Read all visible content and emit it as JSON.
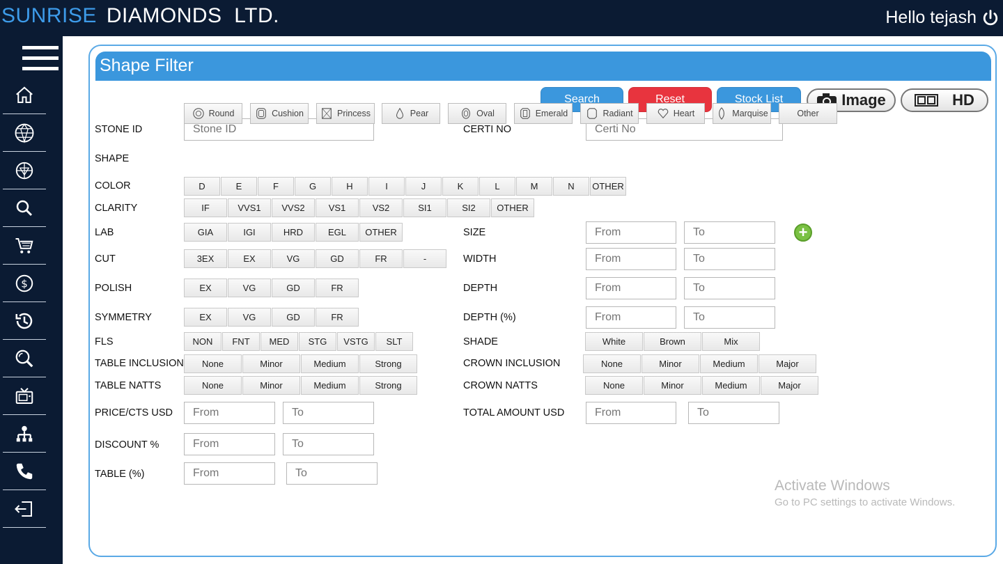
{
  "header": {
    "brand_part1": "SUNRISE",
    "brand_part2": "DIAMONDS  LTD.",
    "greeting": "Hello tejash"
  },
  "sidebar": {
    "items": [
      "menu-icon",
      "home-icon",
      "diamond-icon",
      "diamond-ring-icon",
      "search-icon",
      "cart-icon",
      "dollar-refresh-icon",
      "history-icon",
      "zoom-search-icon",
      "tv-icon",
      "network-icon",
      "phone-icon",
      "logout-icon"
    ]
  },
  "panel": {
    "title": "Shape Filter"
  },
  "actions": {
    "search": "Search",
    "reset": "Reset",
    "stock_list": "Stock List",
    "image": "Image",
    "hd": "HD"
  },
  "labels": {
    "stone_id": "STONE ID",
    "certi_no": "CERTI NO",
    "shape": "SHAPE",
    "color": "COLOR",
    "clarity": "CLARITY",
    "lab": "LAB",
    "size": "SIZE",
    "cut": "CUT",
    "width": "WIDTH",
    "polish": "POLISH",
    "depth": "DEPTH",
    "symmetry": "SYMMETRY",
    "depth_pct": "DEPTH (%)",
    "fls": "FLS",
    "shade": "SHADE",
    "table_inclusion": "TABLE INCLUSION",
    "crown_inclusion": "CROWN INCLUSION",
    "table_natts": "TABLE NATTS",
    "crown_natts": "CROWN NATTS",
    "price_cts": "PRICE/CTS USD",
    "total_amount": "TOTAL AMOUNT USD",
    "discount": "DISCOUNT %",
    "table_pct": "TABLE (%)"
  },
  "placeholders": {
    "stone_id": "Stone ID",
    "certi_no": "Certi No",
    "from": "From",
    "to": "To"
  },
  "shapes": [
    "Round",
    "Cushion",
    "Princess",
    "Pear",
    "Oval",
    "Emerald",
    "Radiant",
    "Heart",
    "Marquise",
    "Other"
  ],
  "colors": [
    "D",
    "E",
    "F",
    "G",
    "H",
    "I",
    "J",
    "K",
    "L",
    "M",
    "N",
    "OTHER"
  ],
  "clarity": [
    "IF",
    "VVS1",
    "VVS2",
    "VS1",
    "VS2",
    "SI1",
    "SI2",
    "OTHER"
  ],
  "lab": [
    "GIA",
    "IGI",
    "HRD",
    "EGL",
    "OTHER"
  ],
  "cut": [
    "3EX",
    "EX",
    "VG",
    "GD",
    "FR",
    "-"
  ],
  "polish": [
    "EX",
    "VG",
    "GD",
    "FR"
  ],
  "symmetry": [
    "EX",
    "VG",
    "GD",
    "FR"
  ],
  "fls": [
    "NON",
    "FNT",
    "MED",
    "STG",
    "VSTG",
    "SLT"
  ],
  "shade": [
    "White",
    "Brown",
    "Mix"
  ],
  "table_inclusion": [
    "None",
    "Minor",
    "Medium",
    "Strong"
  ],
  "crown_inclusion": [
    "None",
    "Minor",
    "Medium",
    "Major"
  ],
  "table_natts": [
    "None",
    "Minor",
    "Medium",
    "Strong"
  ],
  "crown_natts": [
    "None",
    "Minor",
    "Medium",
    "Major"
  ],
  "watermark": {
    "line1": "Activate Windows",
    "line2": "Go to PC settings to activate Windows."
  }
}
